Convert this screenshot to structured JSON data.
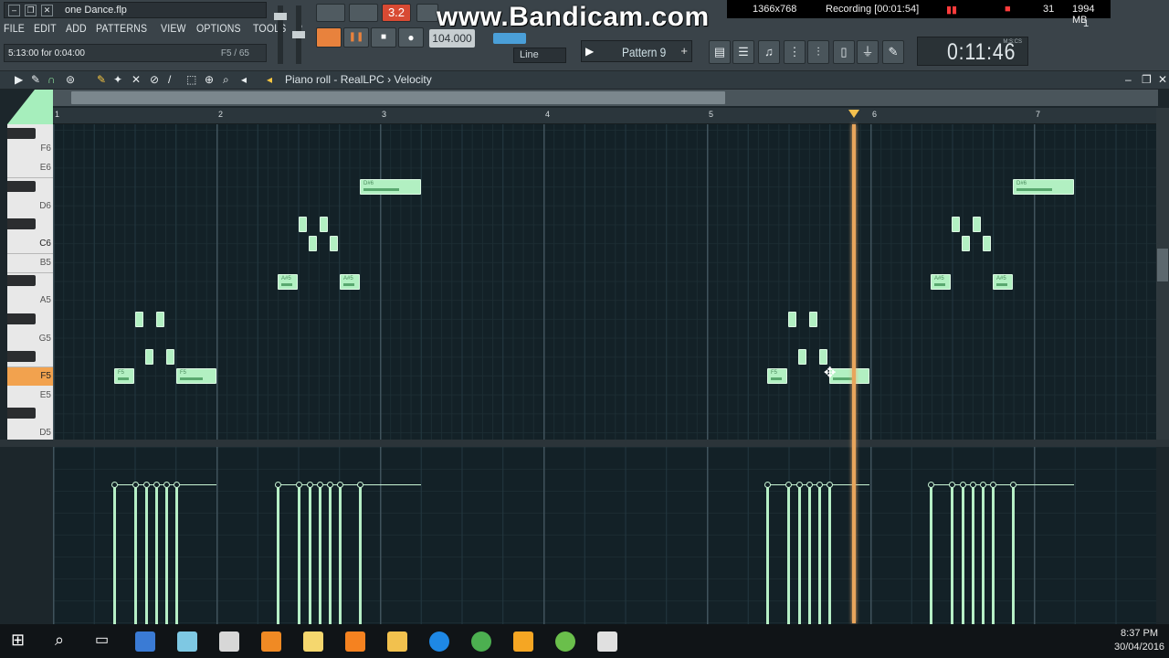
{
  "window": {
    "project_file": "one Dance.flp",
    "menu": [
      "FILE",
      "EDIT",
      "ADD",
      "PATTERNS",
      "VIEW",
      "OPTIONS",
      "TOOLS",
      "?"
    ],
    "hint_left": "5:13:00 for 0:04:00",
    "hint_right": "F5 / 65"
  },
  "transport": {
    "tempo": "104.000",
    "snap": "Line",
    "pattern": "Pattern 9",
    "time": "0:11:46",
    "time_unit": "M:S:CS",
    "counter": "3.2"
  },
  "overlay": {
    "watermark": "www.Bandicam.com",
    "resolution": "1366x768",
    "recording": "Recording [00:01:54]",
    "fps": "31",
    "size": "1994 MB",
    "count": "1"
  },
  "pianoroll": {
    "title": "Piano roll - RealLPC",
    "separator": "›",
    "target": "Velocity",
    "bars": [
      "1",
      "2",
      "3",
      "4",
      "5",
      "6",
      "7"
    ],
    "keys": [
      "F6",
      "E6",
      "D6",
      "C6",
      "B5",
      "A5",
      "G5",
      "F5",
      "E5",
      "D5"
    ],
    "note_labels": {
      "f5": "F5",
      "as5": "A#5",
      "ds6": "D#6"
    }
  },
  "taskbar": {
    "time": "8:37 PM",
    "date": "30/04/2016"
  },
  "colors": {
    "note": "#b2f0c2",
    "playhead": "#e8a55c",
    "grid_bg": "#132127",
    "accent": "#e8823d"
  }
}
